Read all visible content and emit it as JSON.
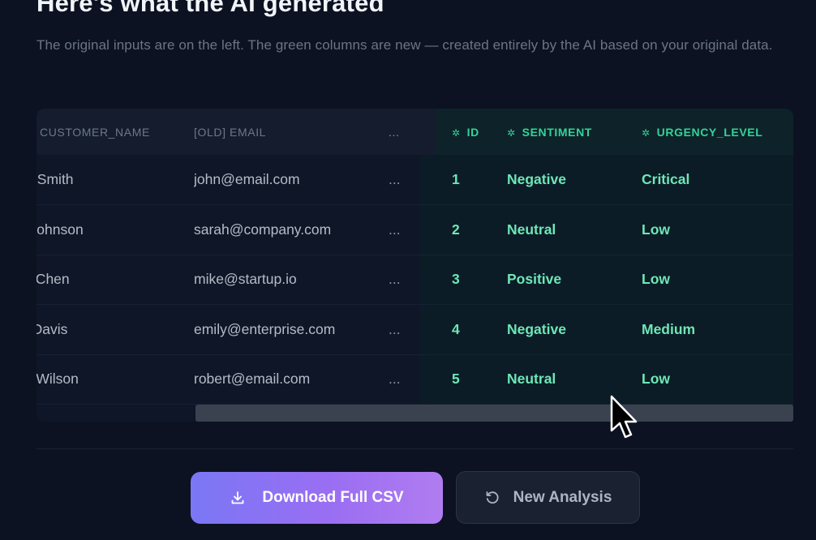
{
  "header": {
    "title": "Here's what the AI generated",
    "subtitle": "The original inputs are on the left. The green columns are new — created entirely by the AI based on your original data."
  },
  "table": {
    "columns": {
      "customer_name": "CUSTOMER_NAME",
      "old_email": "[OLD] EMAIL",
      "more": "...",
      "id": "ID",
      "sentiment": "SENTIMENT",
      "urgency_level": "URGENCY_LEVEL"
    },
    "rows": [
      {
        "customer_name": "John Smith",
        "email": "john@email.com",
        "more": "...",
        "id": "1",
        "sentiment": "Negative",
        "urgency": "Critical"
      },
      {
        "customer_name": "Sarah Johnson",
        "email": "sarah@company.com",
        "more": "...",
        "id": "2",
        "sentiment": "Neutral",
        "urgency": "Low"
      },
      {
        "customer_name": "Mike Chen",
        "email": "mike@startup.io",
        "more": "...",
        "id": "3",
        "sentiment": "Positive",
        "urgency": "Low"
      },
      {
        "customer_name": "Emily Davis",
        "email": "emily@enterprise.com",
        "more": "...",
        "id": "4",
        "sentiment": "Negative",
        "urgency": "Medium"
      },
      {
        "customer_name": "Robert Wilson",
        "email": "robert@email.com",
        "more": "...",
        "id": "5",
        "sentiment": "Neutral",
        "urgency": "Low"
      }
    ]
  },
  "actions": {
    "download_label": "Download Full CSV",
    "new_analysis_label": "New Analysis"
  },
  "icons": {
    "generated_column": "sparkle-icon",
    "download": "download-icon",
    "new_analysis": "refresh-icon"
  },
  "colors": {
    "background": "#0c1222",
    "generated_text": "#6ee7b7",
    "generated_header": "#34d399",
    "primary_gradient_start": "#7a77f5",
    "primary_gradient_end": "#b07cf0"
  }
}
